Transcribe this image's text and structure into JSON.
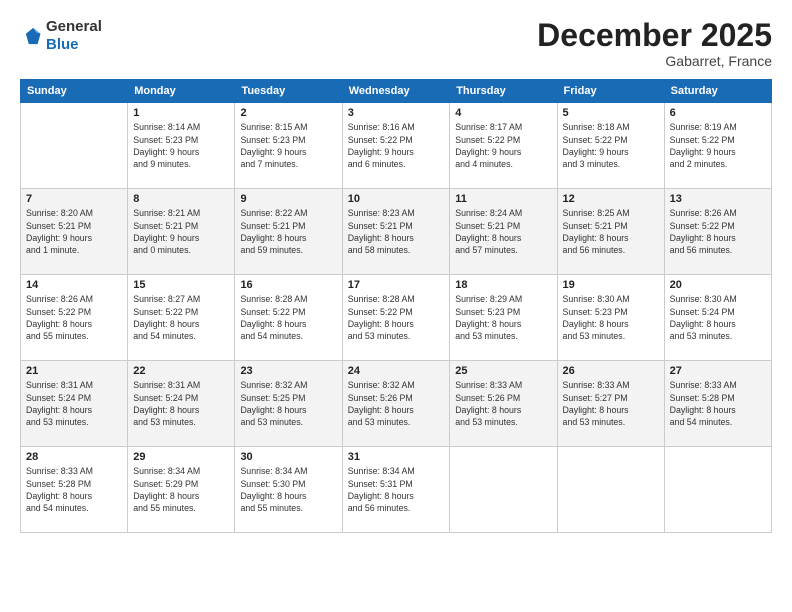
{
  "header": {
    "logo_general": "General",
    "logo_blue": "Blue",
    "month_title": "December 2025",
    "location": "Gabarret, France"
  },
  "columns": [
    "Sunday",
    "Monday",
    "Tuesday",
    "Wednesday",
    "Thursday",
    "Friday",
    "Saturday"
  ],
  "weeks": [
    {
      "days": [
        {
          "num": "",
          "info": ""
        },
        {
          "num": "1",
          "info": "Sunrise: 8:14 AM\nSunset: 5:23 PM\nDaylight: 9 hours\nand 9 minutes."
        },
        {
          "num": "2",
          "info": "Sunrise: 8:15 AM\nSunset: 5:23 PM\nDaylight: 9 hours\nand 7 minutes."
        },
        {
          "num": "3",
          "info": "Sunrise: 8:16 AM\nSunset: 5:22 PM\nDaylight: 9 hours\nand 6 minutes."
        },
        {
          "num": "4",
          "info": "Sunrise: 8:17 AM\nSunset: 5:22 PM\nDaylight: 9 hours\nand 4 minutes."
        },
        {
          "num": "5",
          "info": "Sunrise: 8:18 AM\nSunset: 5:22 PM\nDaylight: 9 hours\nand 3 minutes."
        },
        {
          "num": "6",
          "info": "Sunrise: 8:19 AM\nSunset: 5:22 PM\nDaylight: 9 hours\nand 2 minutes."
        }
      ]
    },
    {
      "days": [
        {
          "num": "7",
          "info": "Sunrise: 8:20 AM\nSunset: 5:21 PM\nDaylight: 9 hours\nand 1 minute."
        },
        {
          "num": "8",
          "info": "Sunrise: 8:21 AM\nSunset: 5:21 PM\nDaylight: 9 hours\nand 0 minutes."
        },
        {
          "num": "9",
          "info": "Sunrise: 8:22 AM\nSunset: 5:21 PM\nDaylight: 8 hours\nand 59 minutes."
        },
        {
          "num": "10",
          "info": "Sunrise: 8:23 AM\nSunset: 5:21 PM\nDaylight: 8 hours\nand 58 minutes."
        },
        {
          "num": "11",
          "info": "Sunrise: 8:24 AM\nSunset: 5:21 PM\nDaylight: 8 hours\nand 57 minutes."
        },
        {
          "num": "12",
          "info": "Sunrise: 8:25 AM\nSunset: 5:21 PM\nDaylight: 8 hours\nand 56 minutes."
        },
        {
          "num": "13",
          "info": "Sunrise: 8:26 AM\nSunset: 5:22 PM\nDaylight: 8 hours\nand 56 minutes."
        }
      ]
    },
    {
      "days": [
        {
          "num": "14",
          "info": "Sunrise: 8:26 AM\nSunset: 5:22 PM\nDaylight: 8 hours\nand 55 minutes."
        },
        {
          "num": "15",
          "info": "Sunrise: 8:27 AM\nSunset: 5:22 PM\nDaylight: 8 hours\nand 54 minutes."
        },
        {
          "num": "16",
          "info": "Sunrise: 8:28 AM\nSunset: 5:22 PM\nDaylight: 8 hours\nand 54 minutes."
        },
        {
          "num": "17",
          "info": "Sunrise: 8:28 AM\nSunset: 5:22 PM\nDaylight: 8 hours\nand 53 minutes."
        },
        {
          "num": "18",
          "info": "Sunrise: 8:29 AM\nSunset: 5:23 PM\nDaylight: 8 hours\nand 53 minutes."
        },
        {
          "num": "19",
          "info": "Sunrise: 8:30 AM\nSunset: 5:23 PM\nDaylight: 8 hours\nand 53 minutes."
        },
        {
          "num": "20",
          "info": "Sunrise: 8:30 AM\nSunset: 5:24 PM\nDaylight: 8 hours\nand 53 minutes."
        }
      ]
    },
    {
      "days": [
        {
          "num": "21",
          "info": "Sunrise: 8:31 AM\nSunset: 5:24 PM\nDaylight: 8 hours\nand 53 minutes."
        },
        {
          "num": "22",
          "info": "Sunrise: 8:31 AM\nSunset: 5:24 PM\nDaylight: 8 hours\nand 53 minutes."
        },
        {
          "num": "23",
          "info": "Sunrise: 8:32 AM\nSunset: 5:25 PM\nDaylight: 8 hours\nand 53 minutes."
        },
        {
          "num": "24",
          "info": "Sunrise: 8:32 AM\nSunset: 5:26 PM\nDaylight: 8 hours\nand 53 minutes."
        },
        {
          "num": "25",
          "info": "Sunrise: 8:33 AM\nSunset: 5:26 PM\nDaylight: 8 hours\nand 53 minutes."
        },
        {
          "num": "26",
          "info": "Sunrise: 8:33 AM\nSunset: 5:27 PM\nDaylight: 8 hours\nand 53 minutes."
        },
        {
          "num": "27",
          "info": "Sunrise: 8:33 AM\nSunset: 5:28 PM\nDaylight: 8 hours\nand 54 minutes."
        }
      ]
    },
    {
      "days": [
        {
          "num": "28",
          "info": "Sunrise: 8:33 AM\nSunset: 5:28 PM\nDaylight: 8 hours\nand 54 minutes."
        },
        {
          "num": "29",
          "info": "Sunrise: 8:34 AM\nSunset: 5:29 PM\nDaylight: 8 hours\nand 55 minutes."
        },
        {
          "num": "30",
          "info": "Sunrise: 8:34 AM\nSunset: 5:30 PM\nDaylight: 8 hours\nand 55 minutes."
        },
        {
          "num": "31",
          "info": "Sunrise: 8:34 AM\nSunset: 5:31 PM\nDaylight: 8 hours\nand 56 minutes."
        },
        {
          "num": "",
          "info": ""
        },
        {
          "num": "",
          "info": ""
        },
        {
          "num": "",
          "info": ""
        }
      ]
    }
  ]
}
